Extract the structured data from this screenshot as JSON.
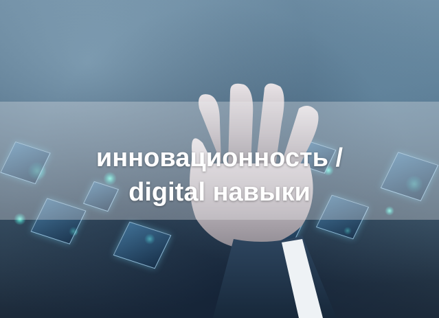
{
  "slide": {
    "caption_line1": "инновационность /",
    "caption_line2": "digital навыки"
  },
  "colors": {
    "overlay_band": "#ebebf0",
    "caption_text": "#ffffff",
    "glow_accent": "#78ffe6"
  },
  "photo": {
    "subject": "hand-reaching-with-floating-digital-cubes"
  }
}
